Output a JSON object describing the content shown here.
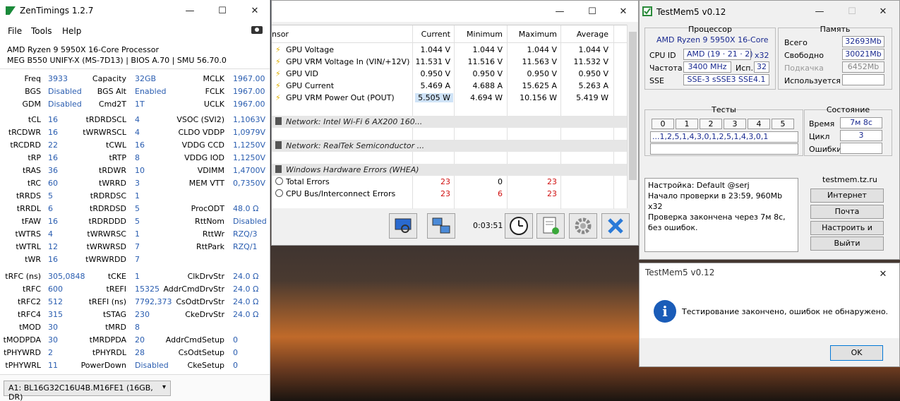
{
  "zentimings": {
    "title": "ZenTimings 1.2.7",
    "menu": [
      "File",
      "Tools",
      "Help"
    ],
    "cpu": "AMD Ryzen 9 5950X 16-Core Processor",
    "board": "MEG B550 UNIFY-X (MS-7D13) | BIOS A.70 | SMU 56.70.0",
    "rows": [
      [
        "Freq",
        "3933",
        "Capacity",
        "32GB",
        "MCLK",
        "1967.00"
      ],
      [
        "BGS",
        "Disabled",
        "BGS Alt",
        "Enabled",
        "FCLK",
        "1967.00"
      ],
      [
        "GDM",
        "Disabled",
        "Cmd2T",
        "1T",
        "UCLK",
        "1967.00"
      ],
      [
        "tCL",
        "16",
        "tRDRDSCL",
        "4",
        "VSOC (SVI2)",
        "1,1063V"
      ],
      [
        "tRCDWR",
        "16",
        "tWRWRSCL",
        "4",
        "CLDO VDDP",
        "1,0979V"
      ],
      [
        "tRCDRD",
        "22",
        "tCWL",
        "16",
        "VDDG CCD",
        "1,1250V"
      ],
      [
        "tRP",
        "16",
        "tRTP",
        "8",
        "VDDG IOD",
        "1,1250V"
      ],
      [
        "tRAS",
        "36",
        "tRDWR",
        "10",
        "VDIMM",
        "1,4700V"
      ],
      [
        "tRC",
        "60",
        "tWRRD",
        "3",
        "MEM VTT",
        "0,7350V"
      ],
      [
        "tRRDS",
        "5",
        "tRDRDSC",
        "1",
        "",
        ""
      ],
      [
        "tRRDL",
        "6",
        "tRDRDSD",
        "5",
        "ProcODT",
        "48.0 Ω"
      ],
      [
        "tFAW",
        "16",
        "tRDRDDD",
        "5",
        "RttNom",
        "Disabled"
      ],
      [
        "tWTRS",
        "4",
        "tWRWRSC",
        "1",
        "RttWr",
        "RZQ/3"
      ],
      [
        "tWTRL",
        "12",
        "tWRWRSD",
        "7",
        "RttPark",
        "RZQ/1"
      ],
      [
        "tWR",
        "16",
        "tWRWRDD",
        "7",
        "",
        ""
      ],
      [
        "tRFC (ns)",
        "305,0848",
        "tCKE",
        "1",
        "ClkDrvStr",
        "24.0 Ω"
      ],
      [
        "tRFC",
        "600",
        "tREFI",
        "15325",
        "AddrCmdDrvStr",
        "24.0 Ω"
      ],
      [
        "tRFC2",
        "512",
        "tREFI (ns)",
        "7792,373",
        "CsOdtDrvStr",
        "24.0 Ω"
      ],
      [
        "tRFC4",
        "315",
        "tSTAG",
        "230",
        "CkeDrvStr",
        "24.0 Ω"
      ],
      [
        "tMOD",
        "30",
        "tMRD",
        "8",
        "",
        ""
      ],
      [
        "tMODPDA",
        "30",
        "tMRDPDA",
        "20",
        "AddrCmdSetup",
        "0"
      ],
      [
        "tPHYWRD",
        "2",
        "tPHYRDL",
        "28",
        "CsOdtSetup",
        "0"
      ],
      [
        "tPHYWRL",
        "11",
        "PowerDown",
        "Disabled",
        "CkeSetup",
        "0"
      ]
    ],
    "module": "A1: BL16G32C16U4B.M16FE1 (16GB, DR)"
  },
  "hwinfo": {
    "columns": [
      "nsor",
      "Current",
      "Minimum",
      "Maximum",
      "Average"
    ],
    "rows": [
      {
        "type": "bolt",
        "name": "GPU Voltage",
        "cur": "1.044 V",
        "min": "1.044 V",
        "max": "1.044 V",
        "avg": "1.044 V"
      },
      {
        "type": "bolt",
        "name": "GPU VRM Voltage In (VIN/+12V)",
        "cur": "11.531 V",
        "min": "11.516 V",
        "max": "11.563 V",
        "avg": "11.532 V"
      },
      {
        "type": "bolt",
        "name": "GPU VID",
        "cur": "0.950 V",
        "min": "0.950 V",
        "max": "0.950 V",
        "avg": "0.950 V"
      },
      {
        "type": "bolt",
        "name": "GPU Current",
        "cur": "5.469 A",
        "min": "4.688 A",
        "max": "15.625 A",
        "avg": "5.263 A"
      },
      {
        "type": "bolt",
        "name": "GPU VRM Power Out (POUT)",
        "cur": "5.505 W",
        "min": "4.694 W",
        "max": "10.156 W",
        "avg": "5.419 W"
      },
      {
        "type": "empty",
        "name": "",
        "cur": "",
        "min": "",
        "max": "",
        "avg": ""
      },
      {
        "type": "group",
        "name": "Network: Intel Wi-Fi 6 AX200 160...",
        "cur": "",
        "min": "",
        "max": "",
        "avg": ""
      },
      {
        "type": "empty",
        "name": "",
        "cur": "",
        "min": "",
        "max": "",
        "avg": ""
      },
      {
        "type": "group",
        "name": "Network: RealTek Semiconductor ...",
        "cur": "",
        "min": "",
        "max": "",
        "avg": ""
      },
      {
        "type": "empty",
        "name": "",
        "cur": "",
        "min": "",
        "max": "",
        "avg": ""
      },
      {
        "type": "group",
        "name": "Windows Hardware Errors (WHEA)",
        "cur": "",
        "min": "",
        "max": "",
        "avg": ""
      },
      {
        "type": "clock",
        "name": "Total Errors",
        "cur": "23",
        "min": "0",
        "max": "23",
        "avg": ""
      },
      {
        "type": "clock",
        "name": "CPU Bus/Interconnect Errors",
        "cur": "23",
        "min": "6",
        "max": "23",
        "avg": ""
      }
    ],
    "timer": "0:03:51"
  },
  "testmem": {
    "title": "TestMem5 v0.12",
    "proc_title": "Процессор",
    "cpu_name": "AMD Ryzen 9 5950X 16-Core",
    "cpuid_label": "CPU ID",
    "cpuid_vendor": "AMD",
    "cpuid_val": "(19 · 21 · 2)",
    "cpuid_threads": "x32",
    "freq_label": "Частота",
    "freq": "3400 MHz",
    "use_label": "Исп.",
    "use": "32",
    "sse_label": "SSE",
    "sse": "SSE-3 sSSE3 SSE4.1",
    "mem_title": "Память",
    "total_label": "Всего",
    "total": "32693Mb",
    "free_label": "Свободно",
    "free": "30021Mb",
    "swap_label": "Подкачка",
    "swap": "6452Mb",
    "used_label": "Используется",
    "used": "",
    "tests_title": "Тесты",
    "tests": [
      "0",
      "1",
      "2",
      "3",
      "4",
      "5"
    ],
    "tests_seq": "...1,2,5,1,4,3,0,1,2,5,1,4,3,0,1",
    "state_title": "Состояние",
    "time_label": "Время",
    "time": "7м 8с",
    "cycle_label": "Цикл",
    "cycle": "3",
    "errors_label": "Ошибки",
    "errors": "",
    "log": [
      "Настройка: Default @serj",
      "Начало проверки в 23:59, 960Mb x32",
      "Проверка закончена через 7м 8с,",
      "без ошибок."
    ],
    "site": "testmem.tz.ru",
    "btn_internet": "Интернет",
    "btn_mail": "Почта",
    "btn_setup": "Настроить и выйти",
    "btn_exit": "Выйти"
  },
  "dialog": {
    "title": "TestMem5 v0.12",
    "message": "Тестирование закончено, ошибок не обнаружено.",
    "ok": "OK"
  }
}
